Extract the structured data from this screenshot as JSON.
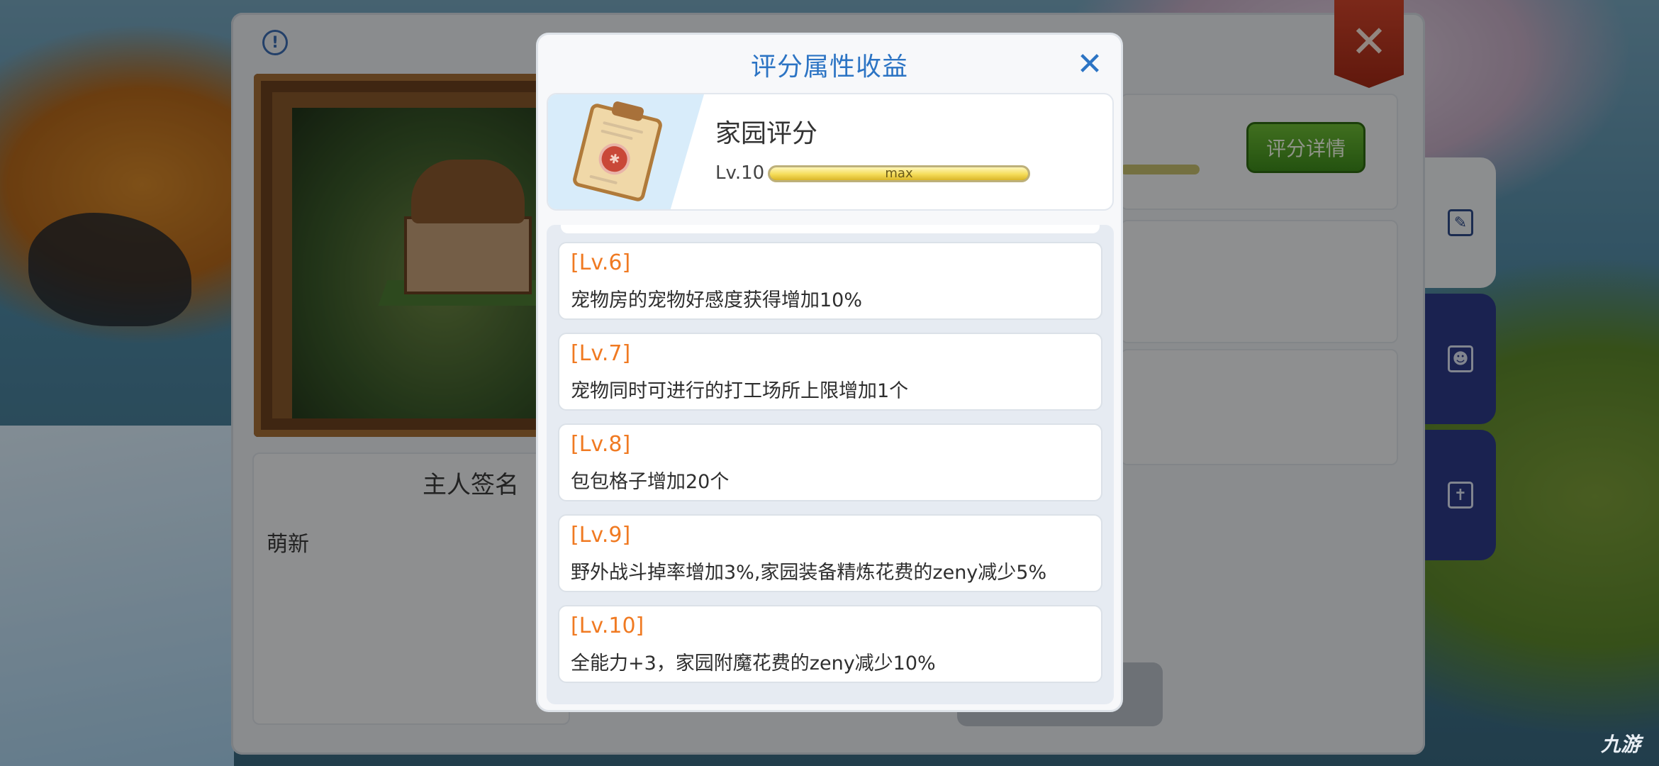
{
  "background": {
    "signature_title": "主人签名",
    "signature_text": "萌新",
    "detail_button": "评分详情"
  },
  "modal": {
    "title": "评分属性收益",
    "close_label": "✕",
    "score": {
      "name": "家园评分",
      "level_label": "Lv.10",
      "progress_text": "max",
      "progress_fraction": 1.0
    },
    "entries": [
      {
        "level": "[Lv.6]",
        "desc": "宠物房的宠物好感度获得增加10%"
      },
      {
        "level": "[Lv.7]",
        "desc": "宠物同时可进行的打工场所上限增加1个"
      },
      {
        "level": "[Lv.8]",
        "desc": "包包格子增加20个"
      },
      {
        "level": "[Lv.9]",
        "desc": "野外战斗掉率增加3%,家园装备精炼花费的zeny减少5%"
      },
      {
        "level": "[Lv.10]",
        "desc": "全能力+3，家园附魔花费的zeny减少10%"
      }
    ]
  },
  "watermark": "九游",
  "colors": {
    "accent_blue": "#2c74c4",
    "level_orange": "#f07a22",
    "detail_green": "#4f9e26",
    "close_red": "#c43a22"
  },
  "icons": [
    "info-icon",
    "close-icon",
    "edit-icon",
    "contacts-icon",
    "cross-icon",
    "clipboard-icon"
  ]
}
